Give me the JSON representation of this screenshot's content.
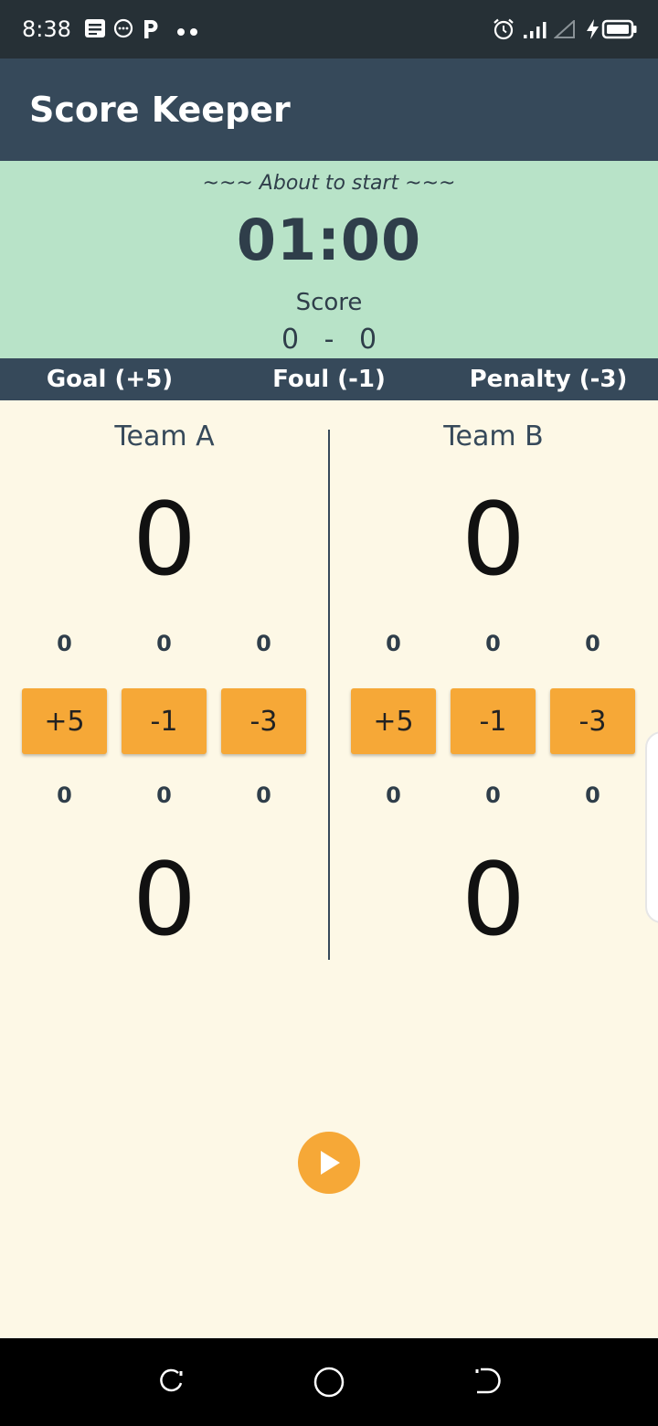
{
  "status_bar": {
    "time": "8:38",
    "icons": [
      "notes-icon",
      "messaging-icon",
      "p-app-icon",
      "more-dots-icon",
      "alarm-icon",
      "signal-icon",
      "signal-empty-icon",
      "charging-icon",
      "battery-icon"
    ]
  },
  "app_bar": {
    "title": "Score Keeper"
  },
  "game": {
    "status": "~~~ About to start ~~~",
    "timer": "01:00",
    "score_label": "Score",
    "score_a": "0",
    "score_sep": "-",
    "score_b": "0"
  },
  "legend": {
    "goal": "Goal (+5)",
    "foul": "Foul (-1)",
    "penalty": "Penalty (-3)"
  },
  "teams": [
    {
      "name": "Team A",
      "score_top": "0",
      "counts_top": [
        "0",
        "0",
        "0"
      ],
      "buttons": [
        "+5",
        "-1",
        "-3"
      ],
      "counts_bottom": [
        "0",
        "0",
        "0"
      ],
      "score_bottom": "0"
    },
    {
      "name": "Team B",
      "score_top": "0",
      "counts_top": [
        "0",
        "0",
        "0"
      ],
      "buttons": [
        "+5",
        "-1",
        "-3"
      ],
      "counts_bottom": [
        "0",
        "0",
        "0"
      ],
      "score_bottom": "0"
    }
  ],
  "controls": {
    "play_icon": "play-icon"
  },
  "nav_bar": {
    "icons": [
      "recents-icon",
      "home-icon",
      "back-icon"
    ]
  },
  "colors": {
    "status_bar": "#263036",
    "app_bar": "#36495a",
    "info_panel": "#b8e3c8",
    "background": "#fdf8e6",
    "accent": "#f6a837",
    "text_dark": "#2f3e4a"
  }
}
